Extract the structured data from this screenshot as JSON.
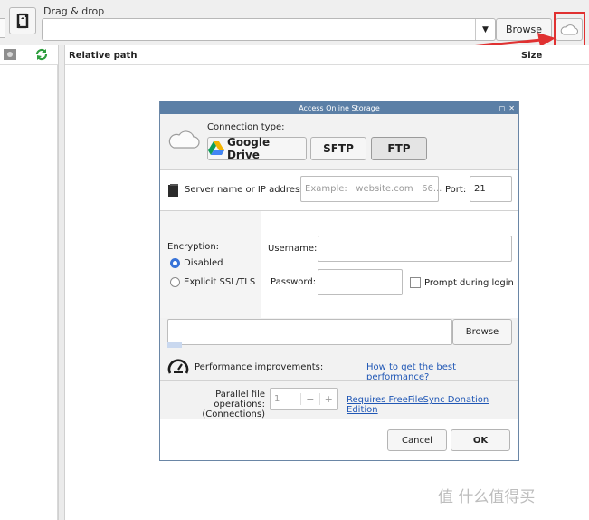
{
  "toolbar": {
    "drag_drop_label": "Drag & drop",
    "path_value": "",
    "browse_label": "Browse"
  },
  "columns": {
    "relative_path": "Relative path",
    "size": "Size"
  },
  "dialog": {
    "title": "Access Online Storage",
    "connection_type_label": "Connection type:",
    "tabs": [
      "Google Drive",
      "SFTP",
      "FTP"
    ],
    "selected_tab": "FTP",
    "server_label": "Server name or IP address:",
    "server_placeholder": "Example:   website.com   66...",
    "port_label": "Port:",
    "port_value": "21",
    "encryption_label": "Encryption:",
    "encryption_options": [
      "Disabled",
      "Explicit SSL/TLS"
    ],
    "encryption_selected": "Disabled",
    "username_label": "Username:",
    "username_value": "",
    "password_label": "Password:",
    "password_value": "",
    "prompt_label": "Prompt during login",
    "browse_label": "Browse",
    "performance_label": "Performance improvements:",
    "performance_link": "How to get the best performance?",
    "parallel_label_1": "Parallel file operations:",
    "parallel_label_2": "(Connections)",
    "parallel_value": "1",
    "donation_link": "Requires FreeFileSync Donation Edition",
    "cancel_label": "Cancel",
    "ok_label": "OK"
  },
  "watermark": "值 什么值得买",
  "colors": {
    "highlight": "#e03131",
    "titlebar": "#5b7fa6",
    "link": "#2057b5",
    "radio_on": "#3873d8"
  }
}
